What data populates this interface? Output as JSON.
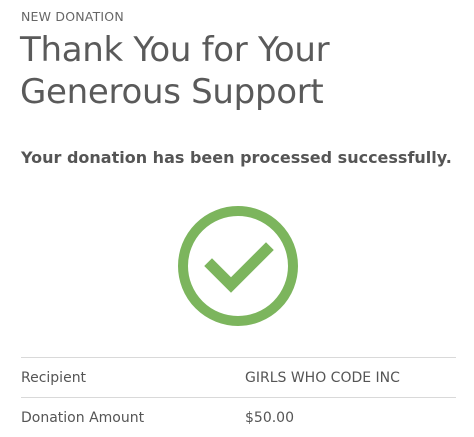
{
  "header": {
    "eyebrow": "NEW DONATION",
    "title": "Thank You for Your Generous Support"
  },
  "message": "Your donation has been processed successfully.",
  "status": {
    "icon": "checkmark-circle-icon",
    "color": "#7cb55d"
  },
  "details": [
    {
      "label": "Recipient",
      "value": "GIRLS WHO CODE INC"
    },
    {
      "label": "Donation Amount",
      "value": "$50.00"
    }
  ]
}
